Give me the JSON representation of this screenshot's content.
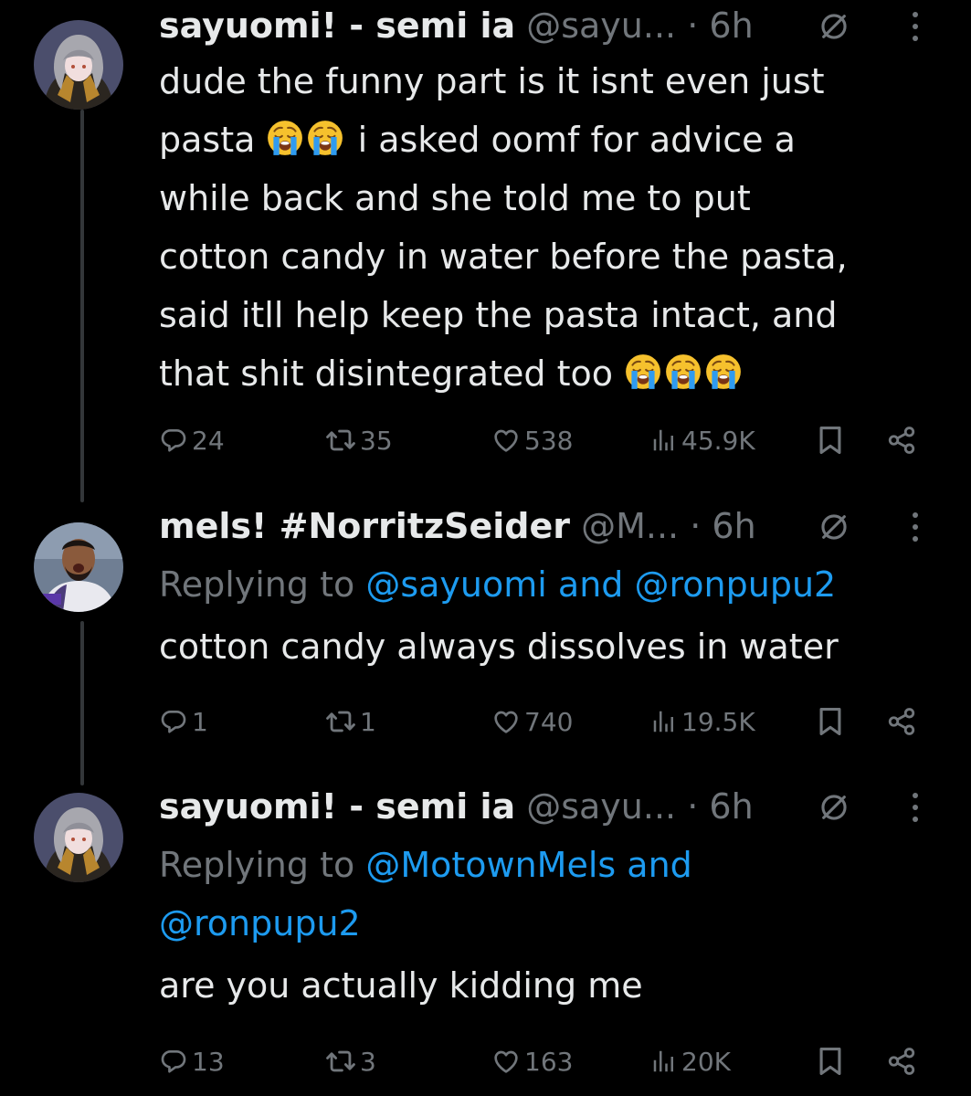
{
  "colors": {
    "background": "#000000",
    "text": "#e7e9ea",
    "muted": "#71767b",
    "link": "#1d9bf0",
    "thread_line": "#333639"
  },
  "tweets": [
    {
      "name": "sayuomi! - semi ia",
      "handle": "@sayu...",
      "dot": "·",
      "time": "6h",
      "icons": [
        "grok-icon",
        "more-icon"
      ],
      "lines": [
        "dude the funny part is it isnt even just",
        "pasta",
        "i asked oomf for advice a",
        "while back and she told me to put",
        "cotton candy in water before the pasta,",
        "said itll help keep the pasta intact, and",
        "that shit disintegrated too"
      ],
      "emoji": "crying-face-emoji",
      "stats": {
        "replies": "24",
        "reposts": "35",
        "likes": "538",
        "views": "45.9K"
      }
    },
    {
      "name": "mels! #NorritzSeider",
      "handle": "@M...",
      "dot": "·",
      "time": "6h",
      "icons": [
        "grok-icon",
        "more-icon"
      ],
      "replying_prefix": "Replying to",
      "replying_users": [
        "@sayuomi",
        "@ronpupu2"
      ],
      "replying_and": "and",
      "text": "cotton candy always dissolves in water",
      "stats": {
        "replies": "1",
        "reposts": "1",
        "likes": "740",
        "views": "19.5K"
      }
    },
    {
      "name": "sayuomi! - semi ia",
      "handle": "@sayu...",
      "dot": "·",
      "time": "6h",
      "icons": [
        "grok-icon",
        "more-icon"
      ],
      "replying_prefix": "Replying to",
      "replying_users": [
        "@MotownMels",
        "@ronpupu2"
      ],
      "replying_and": "and",
      "text": "are you actually kidding me",
      "stats": {
        "replies": "13",
        "reposts": "3",
        "likes": "163",
        "views": "20K"
      }
    }
  ]
}
